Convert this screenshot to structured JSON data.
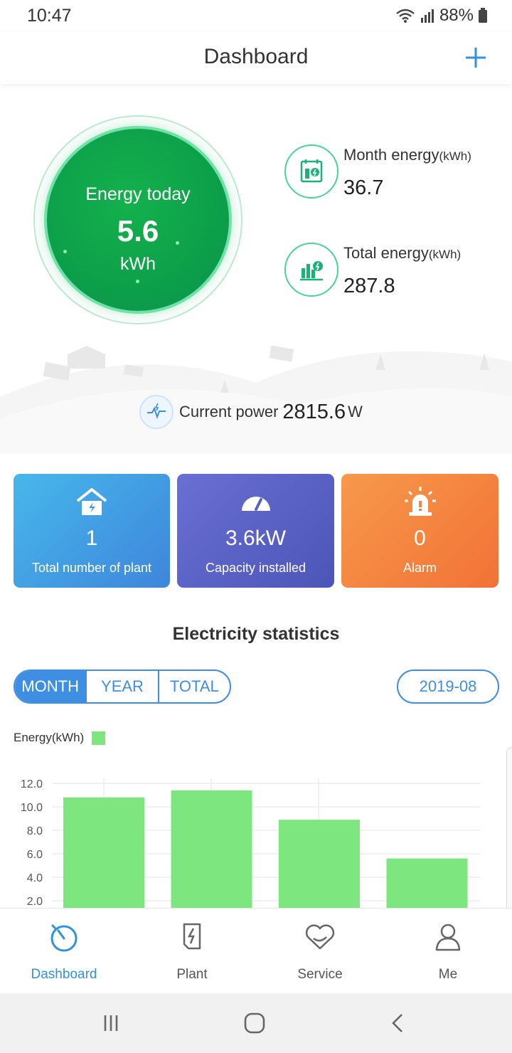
{
  "status_bar": {
    "time": "10:47",
    "battery": "88%"
  },
  "header": {
    "title": "Dashboard",
    "add_icon": "plus-icon"
  },
  "hero": {
    "energy_today_label": "Energy today",
    "energy_today_value": "5.6",
    "energy_today_unit": "kWh",
    "month_energy_label": "Month energy",
    "month_energy_unit": "(kWh)",
    "month_energy_value": "36.7",
    "total_energy_label": "Total energy",
    "total_energy_unit": "(kWh)",
    "total_energy_value": "287.8",
    "current_power_label": "Current power",
    "current_power_value": "2815.6",
    "current_power_unit": "W"
  },
  "cards": [
    {
      "value": "1",
      "label": "Total number of plant",
      "icon": "house-bolt-icon"
    },
    {
      "value": "3.6kW",
      "label": "Capacity installed",
      "icon": "gauge-icon"
    },
    {
      "value": "0",
      "label": "Alarm",
      "icon": "alarm-light-icon"
    }
  ],
  "statistics": {
    "title": "Electricity statistics",
    "tabs": [
      "MONTH",
      "YEAR",
      "TOTAL"
    ],
    "active_tab": "MONTH",
    "date": "2019-08"
  },
  "chart_data": {
    "type": "bar",
    "legend": [
      "Energy(kWh)"
    ],
    "series": [
      {
        "name": "Energy(kWh)",
        "values": [
          10.8,
          11.4,
          8.9,
          5.6
        ]
      }
    ],
    "y_ticks": [
      "2.0",
      "4.0",
      "6.0",
      "8.0",
      "10.0",
      "12.0"
    ],
    "ylim": [
      0,
      12
    ],
    "grid": true,
    "bar_color": "#7ee67e"
  },
  "bottom_nav": [
    {
      "label": "Dashboard",
      "icon": "dashboard-icon",
      "active": true
    },
    {
      "label": "Plant",
      "icon": "plant-bolt-icon",
      "active": false
    },
    {
      "label": "Service",
      "icon": "service-heart-icon",
      "active": false
    },
    {
      "label": "Me",
      "icon": "person-icon",
      "active": false
    }
  ],
  "colors": {
    "accent": "#3e8fe3",
    "energy_green": "#0c9e4a",
    "bar": "#7ee67e"
  }
}
